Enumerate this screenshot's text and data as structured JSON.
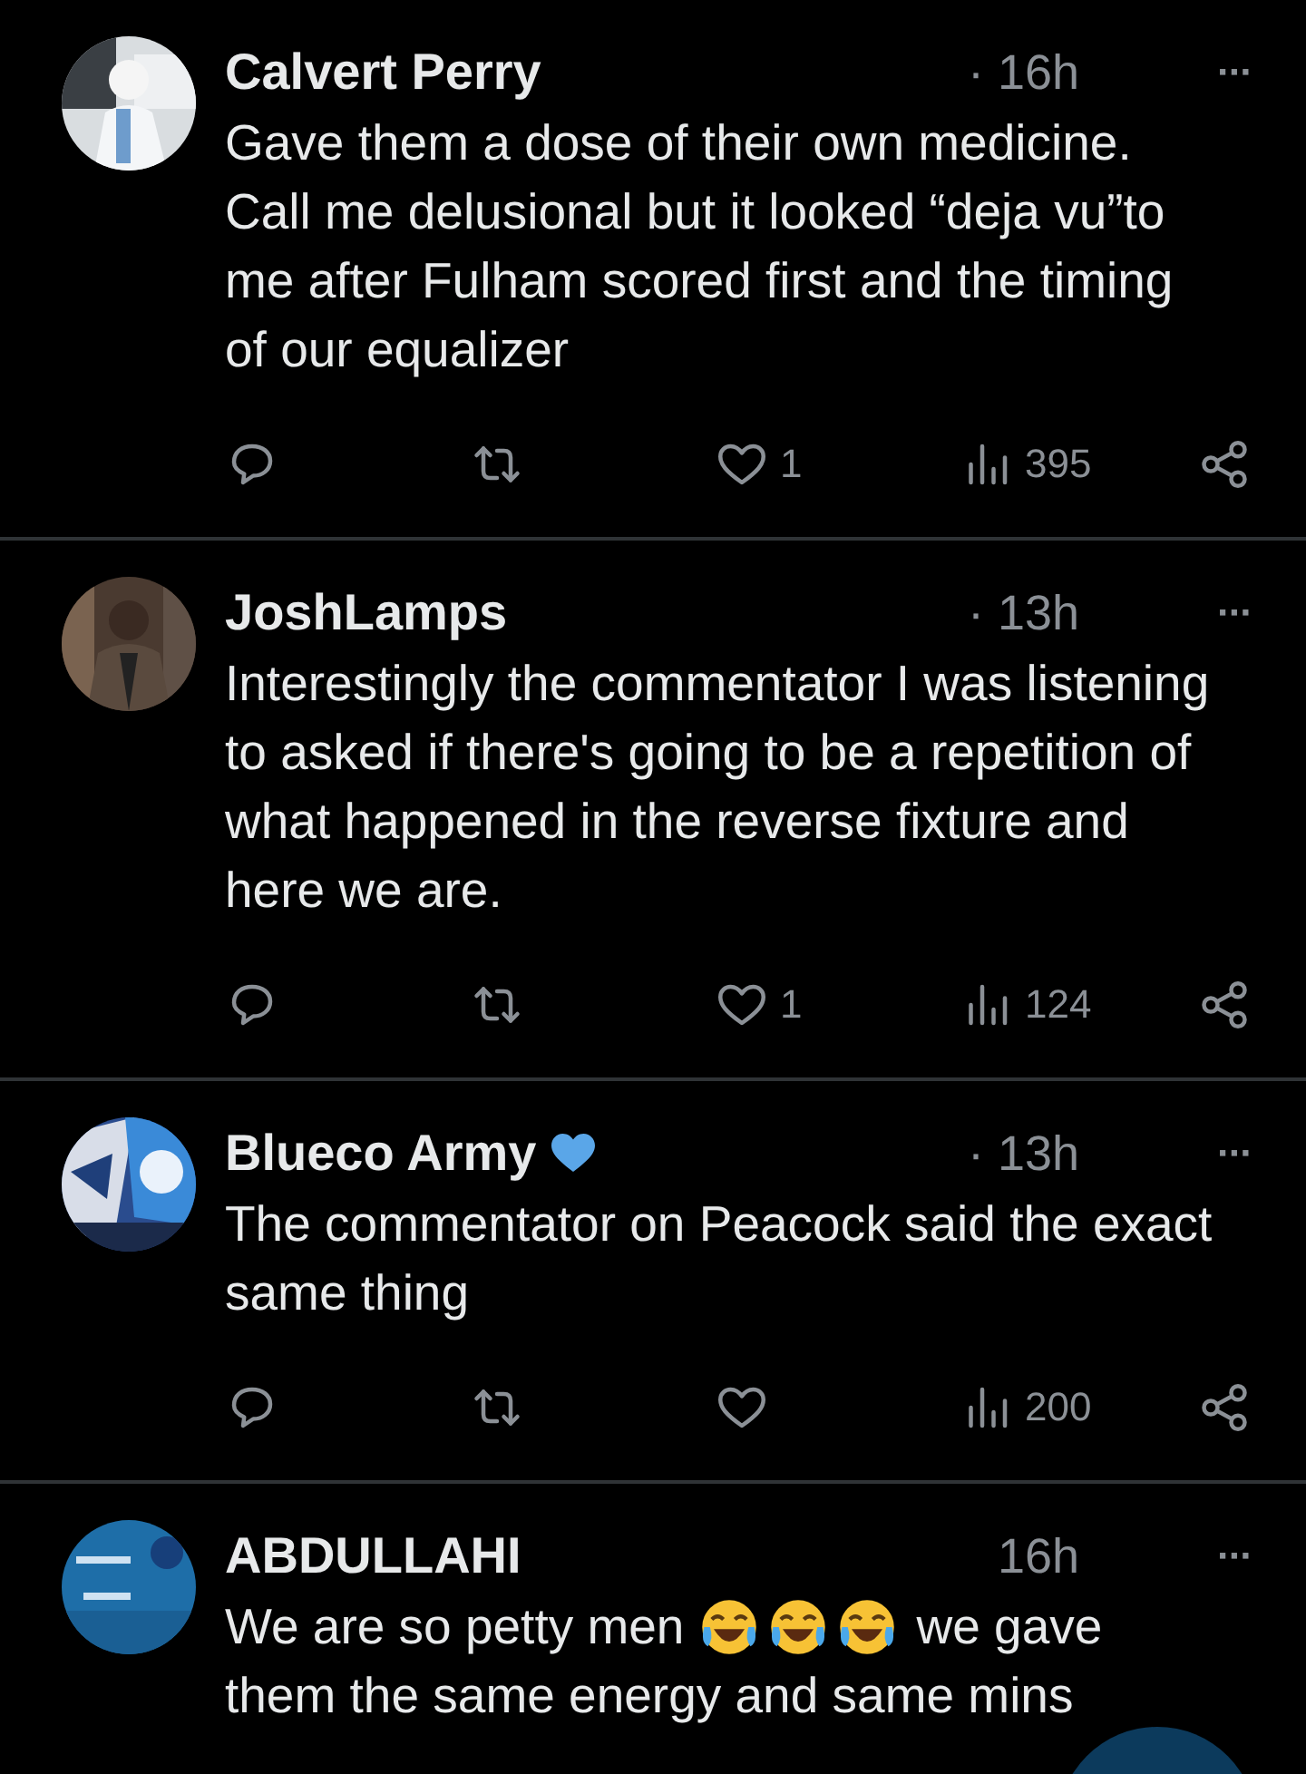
{
  "tweets": [
    {
      "name": "Calvert Perry",
      "heart_badge": false,
      "time": "· 16h",
      "more": "···",
      "body": [
        {
          "kind": "text",
          "text": "Gave them a dose of their own medicine. Call me delusional but it looked “deja vu”to me after Fulham scored first and the timing of our equalizer"
        }
      ],
      "likes": "1",
      "views": "395"
    },
    {
      "name": "JoshLamps",
      "heart_badge": false,
      "time": "· 13h",
      "more": "···",
      "body": [
        {
          "kind": "text",
          "text": "Interestingly the commentator I was listening to asked if there's going to be a repetition of what happened in the reverse fixture and here we are."
        }
      ],
      "likes": "1",
      "views": "124"
    },
    {
      "name": "Blueco Army",
      "heart_badge": true,
      "time": "· 13h",
      "more": "···",
      "body": [
        {
          "kind": "text",
          "text": "The commentator on Peacock said the exact same thing"
        }
      ],
      "views": "200"
    },
    {
      "name": "ABDULLAHI",
      "heart_badge": false,
      "time": "16h",
      "more": "···",
      "body": [
        {
          "kind": "text",
          "text": "We are so petty men"
        },
        {
          "kind": "laugh_emoji"
        },
        {
          "kind": "laugh_emoji"
        },
        {
          "kind": "laugh_emoji"
        },
        {
          "kind": "text",
          "text": "we gave"
        },
        {
          "kind": "text",
          "text": "them the same energy and same mins"
        }
      ]
    }
  ]
}
